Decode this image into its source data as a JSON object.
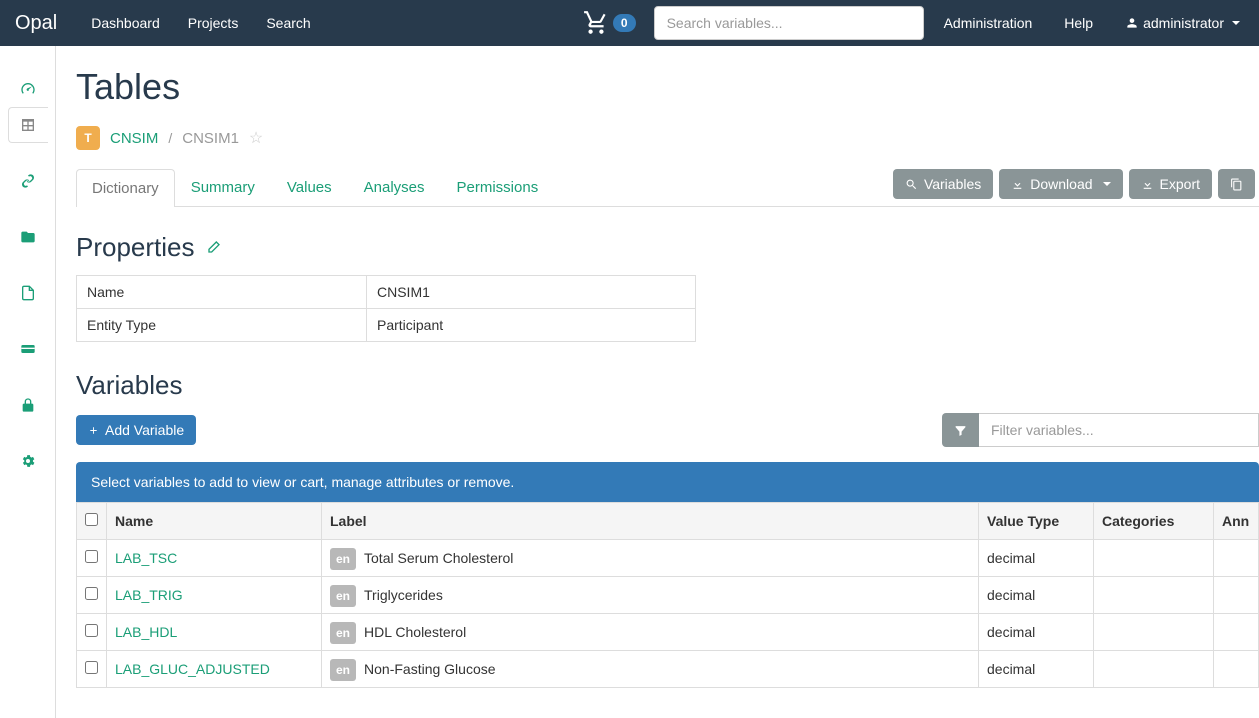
{
  "brand": "Opal",
  "nav": {
    "dashboard": "Dashboard",
    "projects": "Projects",
    "search": "Search"
  },
  "topbar": {
    "cart_count": "0",
    "search_placeholder": "Search variables...",
    "admin": "Administration",
    "help": "Help",
    "user": "administrator"
  },
  "page": {
    "title": "Tables",
    "bc_badge": "T",
    "bc_project": "CNSIM",
    "bc_sep": "/",
    "bc_current": "CNSIM1"
  },
  "tabs": {
    "dictionary": "Dictionary",
    "summary": "Summary",
    "values": "Values",
    "analyses": "Analyses",
    "permissions": "Permissions"
  },
  "actions": {
    "variables": "Variables",
    "download": "Download",
    "export": "Export"
  },
  "properties": {
    "title": "Properties",
    "rows": [
      {
        "k": "Name",
        "v": "CNSIM1"
      },
      {
        "k": "Entity Type",
        "v": "Participant"
      }
    ]
  },
  "variables": {
    "title": "Variables",
    "add_btn": "Add Variable",
    "filter_placeholder": "Filter variables...",
    "info": "Select variables to add to view or cart, manage attributes or remove.",
    "columns": {
      "name": "Name",
      "label": "Label",
      "value_type": "Value Type",
      "categories": "Categories",
      "annotations": "Ann"
    },
    "lang_badge": "en",
    "rows": [
      {
        "name": "LAB_TSC",
        "label": "Total Serum Cholesterol",
        "value_type": "decimal"
      },
      {
        "name": "LAB_TRIG",
        "label": "Triglycerides",
        "value_type": "decimal"
      },
      {
        "name": "LAB_HDL",
        "label": "HDL Cholesterol",
        "value_type": "decimal"
      },
      {
        "name": "LAB_GLUC_ADJUSTED",
        "label": "Non-Fasting Glucose",
        "value_type": "decimal"
      }
    ]
  }
}
